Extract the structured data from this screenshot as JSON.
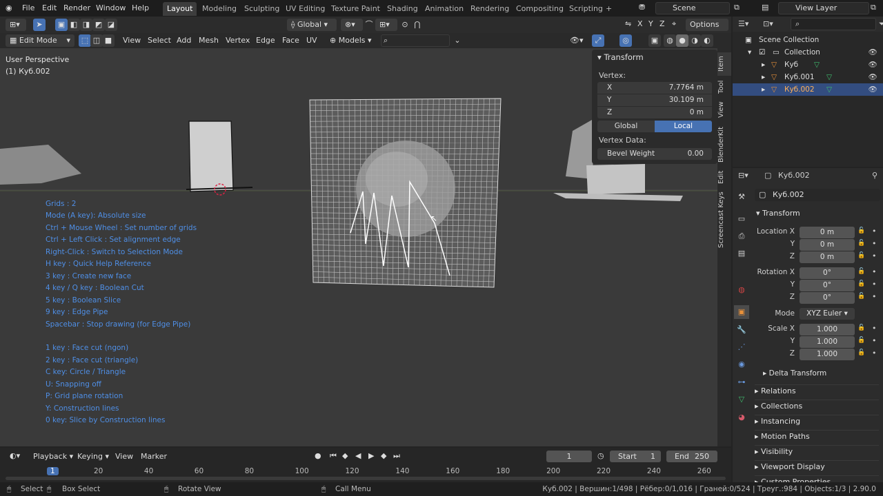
{
  "topbar": {
    "menus": [
      "File",
      "Edit",
      "Render",
      "Window",
      "Help"
    ],
    "workspaces": [
      "Layout",
      "Modeling",
      "Sculpting",
      "UV Editing",
      "Texture Paint",
      "Shading",
      "Animation",
      "Rendering",
      "Compositing",
      "Scripting"
    ],
    "add_tab": "+",
    "scene_name": "Scene",
    "view_layer": "View Layer"
  },
  "header1": {
    "orientation": "Global",
    "axes": [
      "X",
      "Y",
      "Z"
    ],
    "options": "Options"
  },
  "header2": {
    "mode": "Edit Mode",
    "menus": [
      "View",
      "Select",
      "Add",
      "Mesh",
      "Vertex",
      "Edge",
      "Face",
      "UV"
    ],
    "models_dropdown": "Models"
  },
  "viewport": {
    "perspective": "User Perspective",
    "object_label": "(1) Куб.002",
    "help_lines": [
      "Grids : 2",
      "Mode (A key): Absolute size",
      "Ctrl + Mouse Wheel : Set number of grids",
      "Ctrl + Left Click : Set alignment edge",
      "Right-Click : Switch to Selection Mode",
      "H key : Quick Help Reference",
      "3 key : Create new face",
      "4 key / Q key : Boolean Cut",
      "5 key : Boolean Slice",
      "9 key : Edge Pipe",
      "Spacebar : Stop drawing (for Edge Pipe)",
      "",
      "1 key : Face cut (ngon)",
      "2 key : Face cut (triangle)",
      "C key: Circle / Triangle",
      "U: Snapping off",
      "P: Grid plane rotation",
      "Y: Construction lines",
      "0 key: Slice by Construction lines"
    ]
  },
  "npanel": {
    "title": "Transform",
    "vertex_label": "Vertex:",
    "x_label": "X",
    "x_value": "7.7764 m",
    "y_label": "Y",
    "y_value": "30.109 m",
    "z_label": "Z",
    "z_value": "0 m",
    "global": "Global",
    "local": "Local",
    "vertex_data_label": "Vertex Data:",
    "bevel_label": "Bevel Weight",
    "bevel_value": "0.00",
    "tabs": [
      "Item",
      "Tool",
      "View",
      "BlenderKit",
      "Edit",
      "Screencast Keys"
    ]
  },
  "outliner": {
    "scene_collection": "Scene Collection",
    "collection": "Collection",
    "objects": [
      "Куб",
      "Куб.001",
      "Куб.002"
    ]
  },
  "properties": {
    "object_name_header": "Куб.002",
    "object_name_field": "Куб.002",
    "transform_title": "Transform",
    "location_label": "Location X",
    "loc": [
      "0 m",
      "0 m",
      "0 m"
    ],
    "rotation_label": "Rotation X",
    "rot": [
      "0°",
      "0°",
      "0°"
    ],
    "y_label": "Y",
    "z_label": "Z",
    "mode_label": "Mode",
    "mode_value": "XYZ Euler",
    "scale_label": "Scale X",
    "scale": [
      "1.000",
      "1.000",
      "1.000"
    ],
    "delta": "Delta Transform",
    "sections": [
      "Relations",
      "Collections",
      "Instancing",
      "Motion Paths",
      "Visibility",
      "Viewport Display",
      "Custom Properties"
    ]
  },
  "timeline": {
    "menus": [
      "Playback",
      "Keying",
      "View",
      "Marker"
    ],
    "current_frame": "1",
    "start_label": "Start",
    "start_value": "1",
    "end_label": "End",
    "end_value": "250",
    "ticks": [
      "1",
      "20",
      "40",
      "60",
      "80",
      "100",
      "120",
      "140",
      "160",
      "180",
      "200",
      "220",
      "240",
      "260"
    ]
  },
  "status": {
    "select": "Select",
    "box_select": "Box Select",
    "rotate_view": "Rotate View",
    "call_menu": "Call Menu",
    "stats": "Куб.002 | Вершин:1/498 | Рёбер:0/1,016 | Граней:0/524 | Треуг.:984 | Objects:1/3 | 2.90.0"
  },
  "colors": {
    "accent": "#4772b3",
    "help_text": "#4f8fe6",
    "active_row": "#334d80"
  }
}
